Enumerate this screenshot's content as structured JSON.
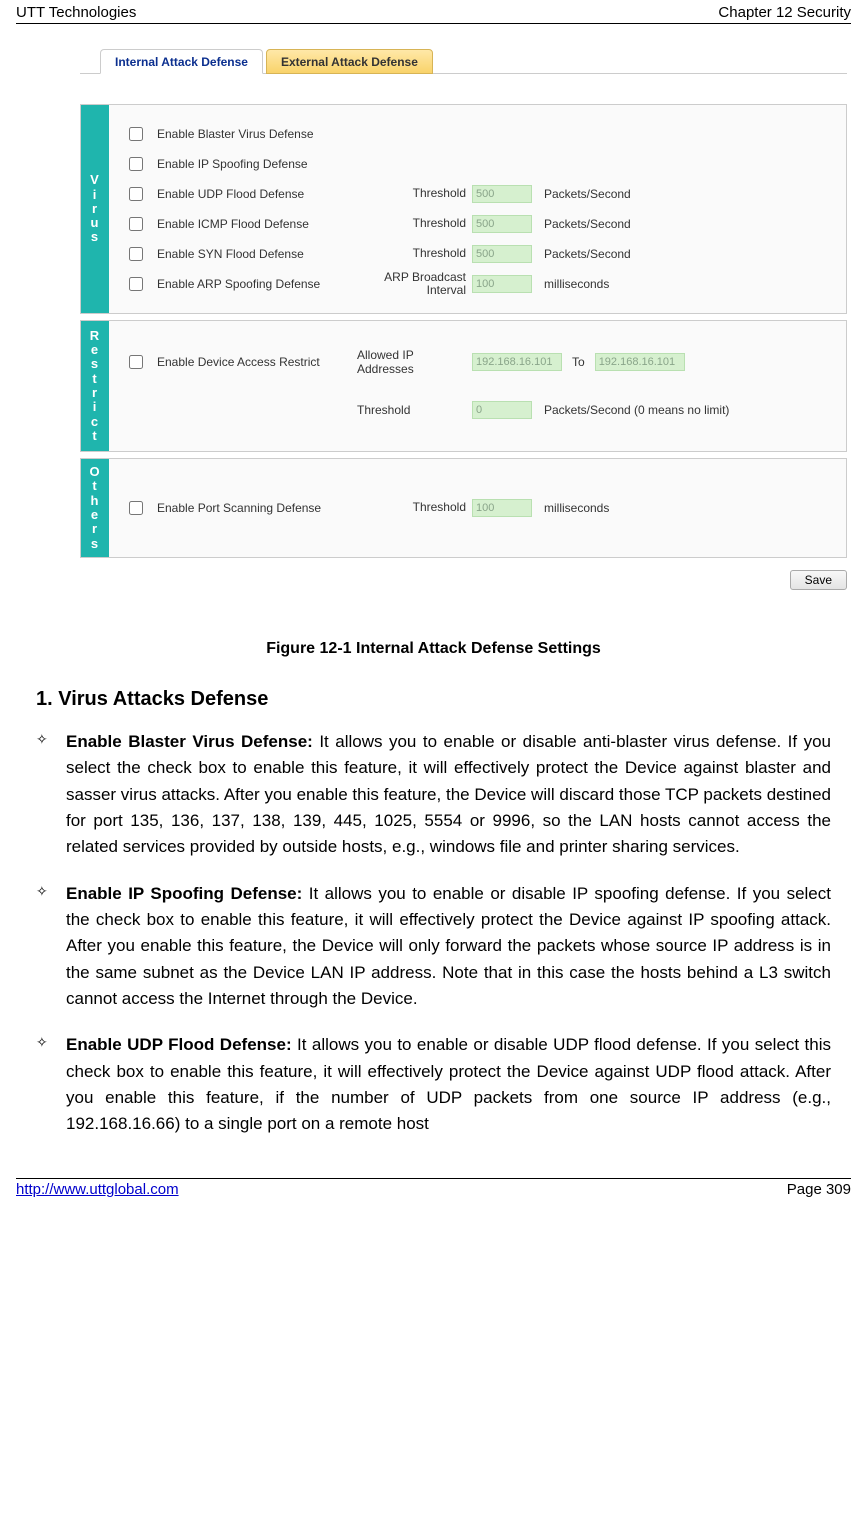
{
  "header": {
    "left": "UTT Technologies",
    "right": "Chapter 12 Security"
  },
  "footer": {
    "left": "http://www.uttglobal.com",
    "right": "Page 309"
  },
  "tabs": {
    "active": "Internal Attack Defense",
    "inactive": "External Attack Defense"
  },
  "virus": {
    "side": "Virus",
    "rows": [
      {
        "label": "Enable Blaster Virus Defense",
        "mid": "",
        "val": "",
        "unit": ""
      },
      {
        "label": "Enable IP Spoofing Defense",
        "mid": "",
        "val": "",
        "unit": ""
      },
      {
        "label": "Enable UDP Flood Defense",
        "mid": "Threshold",
        "val": "500",
        "unit": "Packets/Second"
      },
      {
        "label": "Enable ICMP Flood Defense",
        "mid": "Threshold",
        "val": "500",
        "unit": "Packets/Second"
      },
      {
        "label": "Enable SYN Flood Defense",
        "mid": "Threshold",
        "val": "500",
        "unit": "Packets/Second"
      },
      {
        "label": "Enable ARP Spoofing Defense",
        "mid": "ARP Broadcast Interval",
        "val": "100",
        "unit": "milliseconds"
      }
    ]
  },
  "restrict": {
    "side": "Restrict",
    "row1": {
      "label": "Enable Device Access Restrict",
      "mid": "Allowed IP Addresses",
      "ip1": "192.168.16.101",
      "to": "To",
      "ip2": "192.168.16.101"
    },
    "row2": {
      "mid": "Threshold",
      "val": "0",
      "unit": "Packets/Second (0 means no limit)"
    }
  },
  "others": {
    "side": "Others",
    "row": {
      "label": "Enable Port Scanning Defense",
      "mid": "Threshold",
      "val": "100",
      "unit": "milliseconds"
    }
  },
  "save_label": "Save",
  "figure_caption": "Figure 12-1 Internal Attack Defense Settings",
  "section": {
    "heading": "1.    Virus Attacks Defense",
    "bullets": [
      {
        "title": "Enable Blaster Virus Defense:",
        "body": " It allows you to enable or disable anti-blaster virus defense. If you select the check box to enable this feature, it will effectively protect the Device against blaster and sasser virus attacks. After you enable this feature, the Device will discard those TCP packets destined for port 135, 136, 137, 138, 139, 445, 1025, 5554 or 9996, so the LAN hosts cannot access the related services provided by outside hosts, e.g., windows file and printer sharing services."
      },
      {
        "title": "Enable IP Spoofing Defense:",
        "body": " It allows you to enable or disable IP spoofing defense. If you select the check box to enable this feature, it will effectively protect the Device against IP spoofing attack. After you enable this feature, the Device will only forward the packets whose source IP address is in the same subnet as the Device LAN IP address. Note that in this case the hosts behind a L3 switch cannot access the Internet through the Device."
      },
      {
        "title": "Enable UDP Flood Defense:",
        "body": " It allows you to enable or disable UDP flood defense. If you select this check box to enable this feature, it will effectively protect the Device against UDP flood attack. After you enable this feature, if the number of UDP packets from one source IP address (e.g., 192.168.16.66) to a single port on a remote host"
      }
    ]
  },
  "diamond": "✧"
}
